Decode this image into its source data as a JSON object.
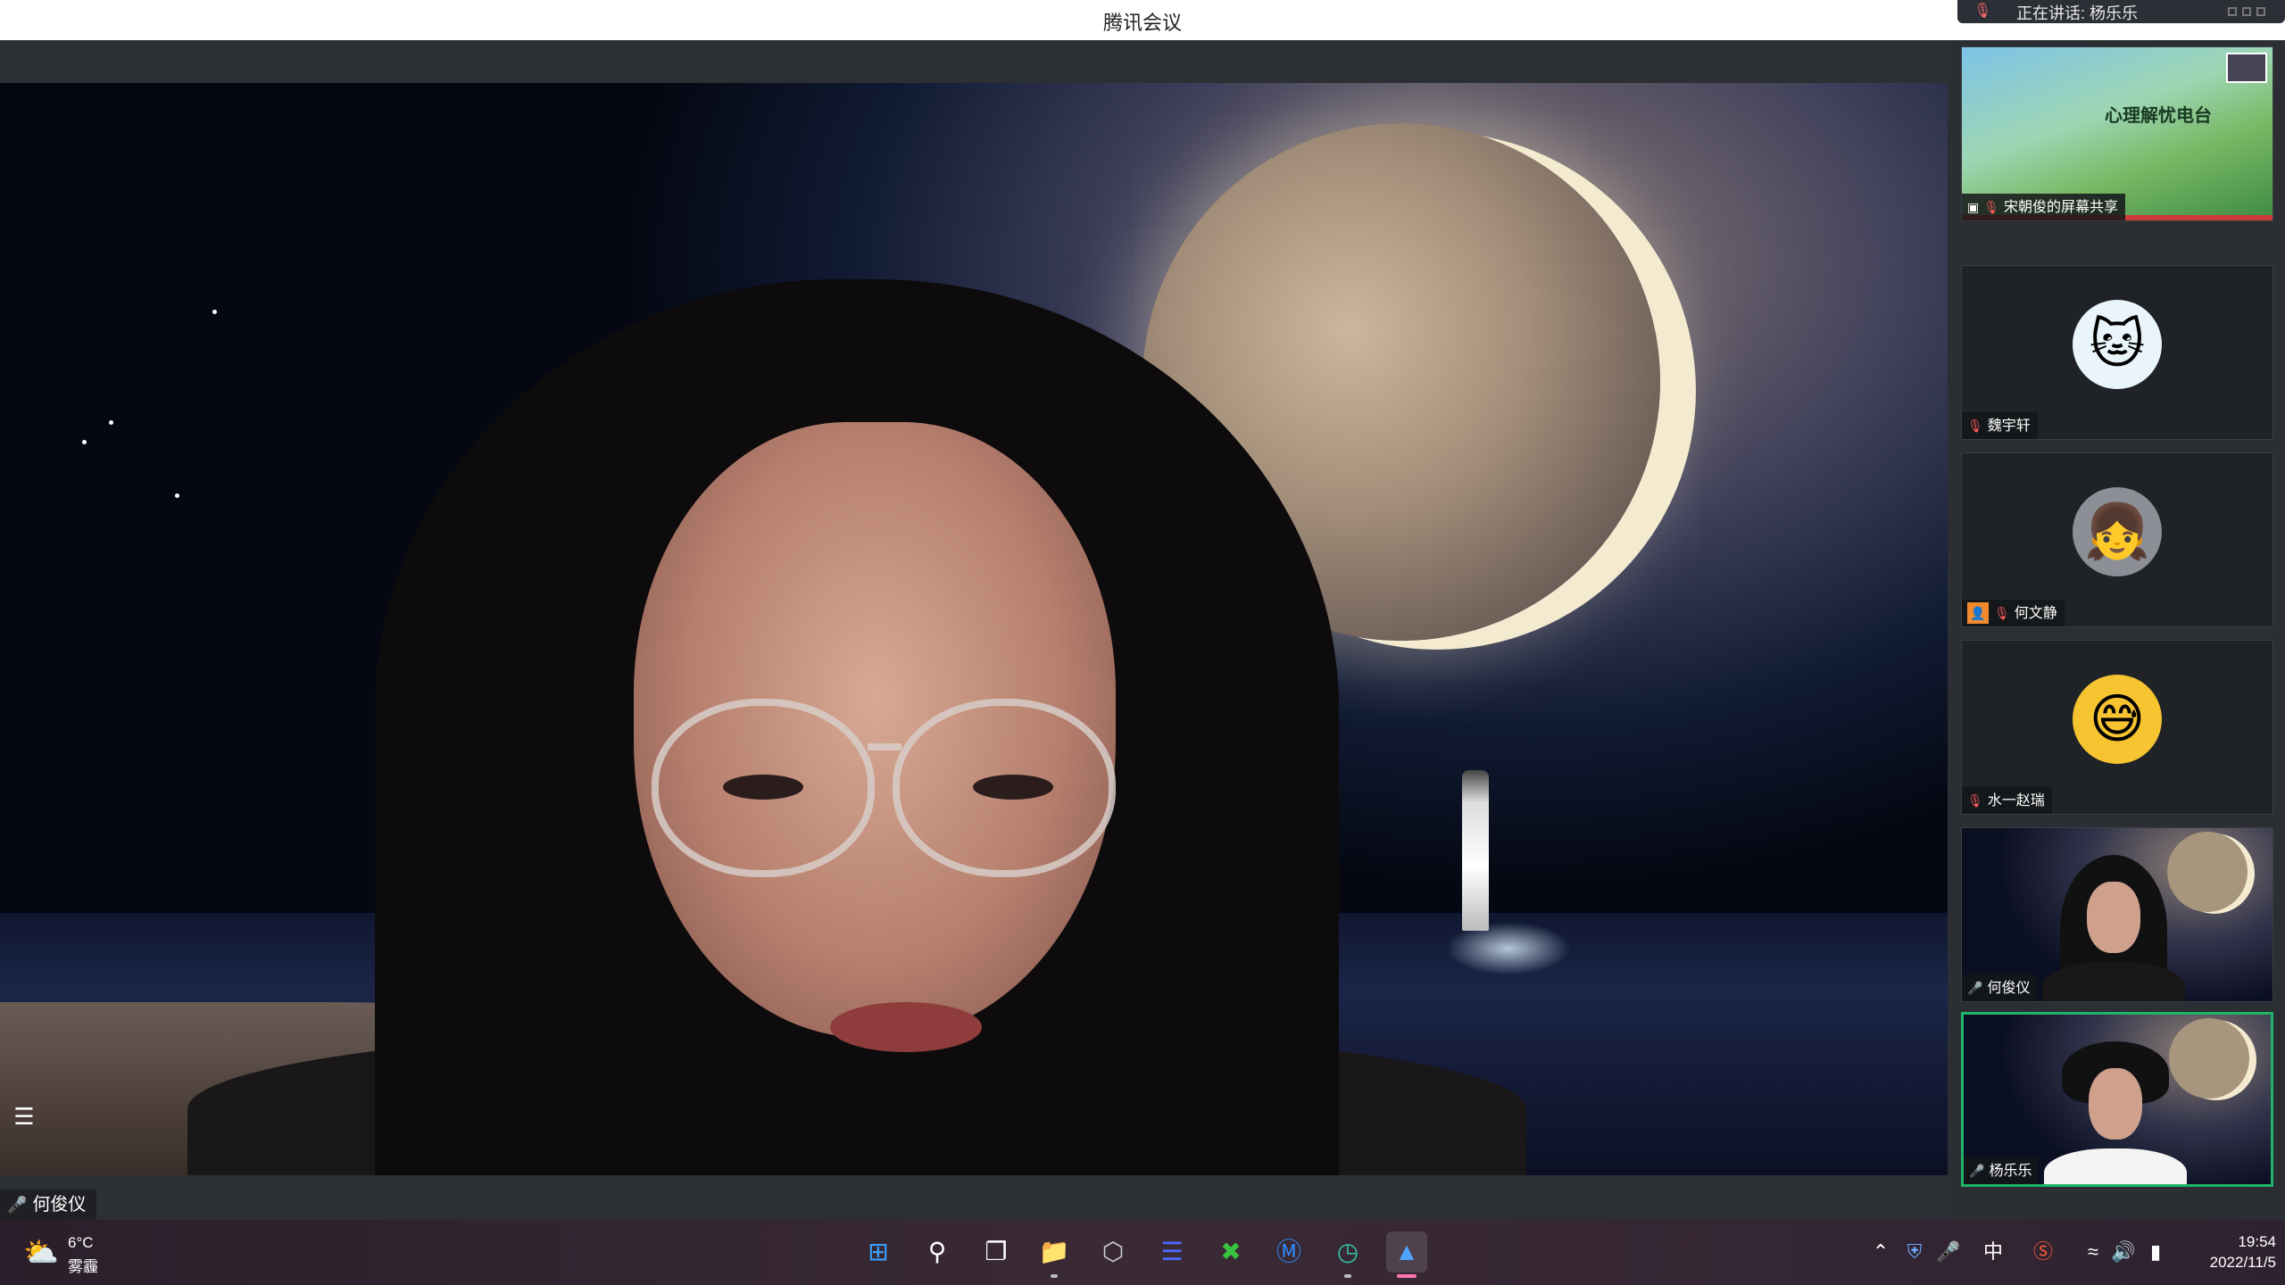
{
  "window": {
    "title": "腾讯会议",
    "speaking_indicator": "正在讲话: 杨乐乐"
  },
  "main_video": {
    "participant_name": "何俊仪"
  },
  "participants": [
    {
      "name": "宋朝俊的屏幕共享",
      "type": "screen-share",
      "share_title": "心理解忧电台",
      "mic": "muted"
    },
    {
      "name": "魏宇轩",
      "type": "avatar",
      "avatar_icon": "cartoon-cat-avatar",
      "mic": "muted"
    },
    {
      "name": "何文静",
      "type": "avatar",
      "avatar_icon": "girl-avatar",
      "mic": "muted",
      "host": true
    },
    {
      "name": "水一赵瑞",
      "type": "avatar",
      "avatar_icon": "sweat-smile-emoji-avatar",
      "mic": "muted"
    },
    {
      "name": "何俊仪",
      "type": "video",
      "mic": "on"
    },
    {
      "name": "杨乐乐",
      "type": "video",
      "mic": "on",
      "active_speaker": true
    }
  ],
  "taskbar": {
    "weather": {
      "temp": "6°C",
      "desc": "雾霾",
      "icon": "partly-cloudy-icon"
    },
    "apps": [
      "windows-start-icon",
      "search-icon",
      "task-view-icon",
      "file-explorer-icon",
      "unity-hub-icon",
      "visual-studio-icon",
      "xbox-icon",
      "kugou-music-icon",
      "edge-browser-icon",
      "tencent-meeting-icon"
    ],
    "tray": {
      "ime": "中",
      "icons": [
        "chevron-up-icon",
        "defender-icon",
        "microphone-icon",
        "sogou-ime-icon",
        "wifi-icon",
        "volume-icon",
        "battery-icon"
      ]
    },
    "clock": {
      "time": "19:54",
      "date": "2022/11/5"
    }
  },
  "colors": {
    "accent_green": "#1fb46a",
    "muted_red": "#ff5c5c",
    "host_orange": "#f08a2c"
  }
}
